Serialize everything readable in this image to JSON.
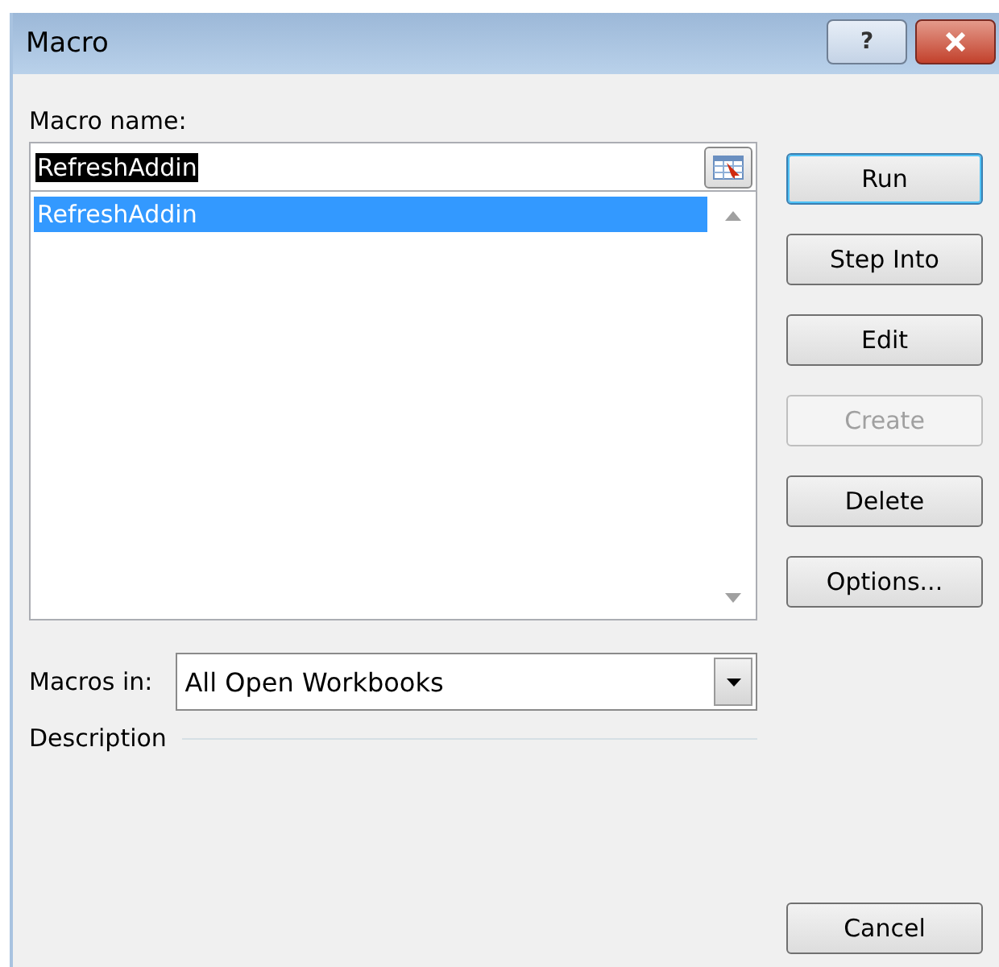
{
  "window": {
    "title": "Macro",
    "help": "?"
  },
  "macro_name": {
    "label": "Macro name:",
    "value": "RefreshAddin",
    "text_selected": true
  },
  "macro_list": [
    {
      "label": "RefreshAddin",
      "selected": true
    }
  ],
  "buttons": [
    {
      "label": "Run",
      "disabled": false,
      "default": true
    },
    {
      "label": "Step Into",
      "disabled": false,
      "default": false
    },
    {
      "label": "Edit",
      "disabled": false,
      "default": false
    },
    {
      "label": "Create",
      "disabled": true,
      "default": false
    },
    {
      "label": "Delete",
      "disabled": false,
      "default": false
    },
    {
      "label": "Options...",
      "disabled": false,
      "default": false
    }
  ],
  "macros_in": {
    "label": "Macros in:",
    "value": "All Open Workbooks"
  },
  "description": {
    "label": "Description"
  },
  "cancel": {
    "label": "Cancel"
  }
}
